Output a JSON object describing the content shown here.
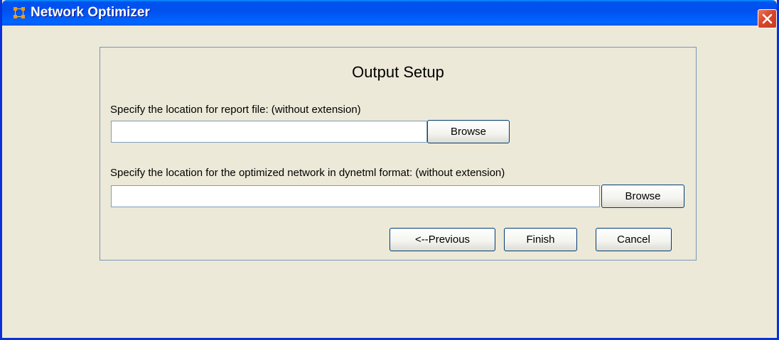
{
  "window": {
    "title": "Network Optimizer",
    "icon": "network-grid-icon",
    "close_icon": "close-icon",
    "titlebar_color": "#0054e3",
    "close_color": "#d9452a"
  },
  "panel": {
    "heading": "Output Setup",
    "report": {
      "label": "Specify the location for report file: (without extension)",
      "value": "",
      "browse_label": "Browse"
    },
    "network": {
      "label": "Specify the location for the optimized network in dynetml format: (without extension)",
      "value": "",
      "browse_label": "Browse"
    },
    "buttons": {
      "previous": "<--Previous",
      "finish": "Finish",
      "cancel": "Cancel"
    }
  }
}
